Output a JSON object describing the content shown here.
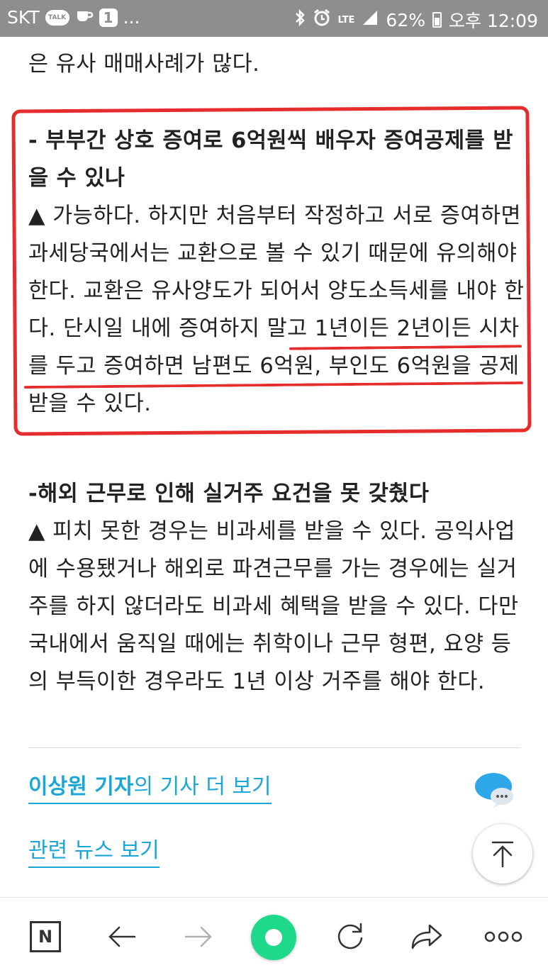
{
  "status_bar": {
    "carrier": "SKT",
    "talk_badge": "TALK",
    "notification_count": "1",
    "more": "...",
    "network": "LTE",
    "battery": "62%",
    "time": "오후 12:09"
  },
  "article": {
    "intro_tail": "은 유사 매매사례가 많다.",
    "qa": [
      {
        "question": "- 부부간 상호 증여로 6억원씩 배우자 증여공제를 받을 수 있나",
        "answer": "▲ 가능하다. 하지만 처음부터 작정하고 서로 증여하면 과세당국에서는 교환으로 볼 수 있기 때문에 유의해야 한다. 교환은 유사양도가 되어서 양도소득세를 내야 한다. 단시일 내에 증여하지 말고 1년이든 2년이든 시차를 두고 증여하면 남편도 6억원, 부인도 6억원을 공제 받을 수 있다."
      },
      {
        "question": "-해외 근무로 인해 실거주 요건을 못 갖췄다",
        "answer": "▲ 피치 못한 경우는 비과세를 받을 수 있다. 공익사업에 수용됐거나 해외로 파견근무를 가는 경우에는 실거주를 하지 않더라도 비과세 혜택을 받을 수 있다. 다만 국내에서 움직일 때에는 취학이나 근무 형편, 요양 등의 부득이한 경우라도 1년 이상 거주를 해야 한다."
      }
    ]
  },
  "links": {
    "author_name": "이상원 기자",
    "author_suffix": "의 기사 더 보기",
    "related": "관련 뉴스 보기"
  },
  "bottom_bar": {
    "home_label": "N",
    "icons": [
      "naver-home-icon",
      "back-arrow-icon",
      "forward-arrow-icon",
      "green-dot-icon",
      "refresh-icon",
      "share-icon",
      "more-icon"
    ]
  },
  "colors": {
    "status_bar_bg": "#8e8e8e",
    "link": "#1aa6d6",
    "annotation_red": "#e52d2d",
    "green_button": "#1ed98a"
  }
}
